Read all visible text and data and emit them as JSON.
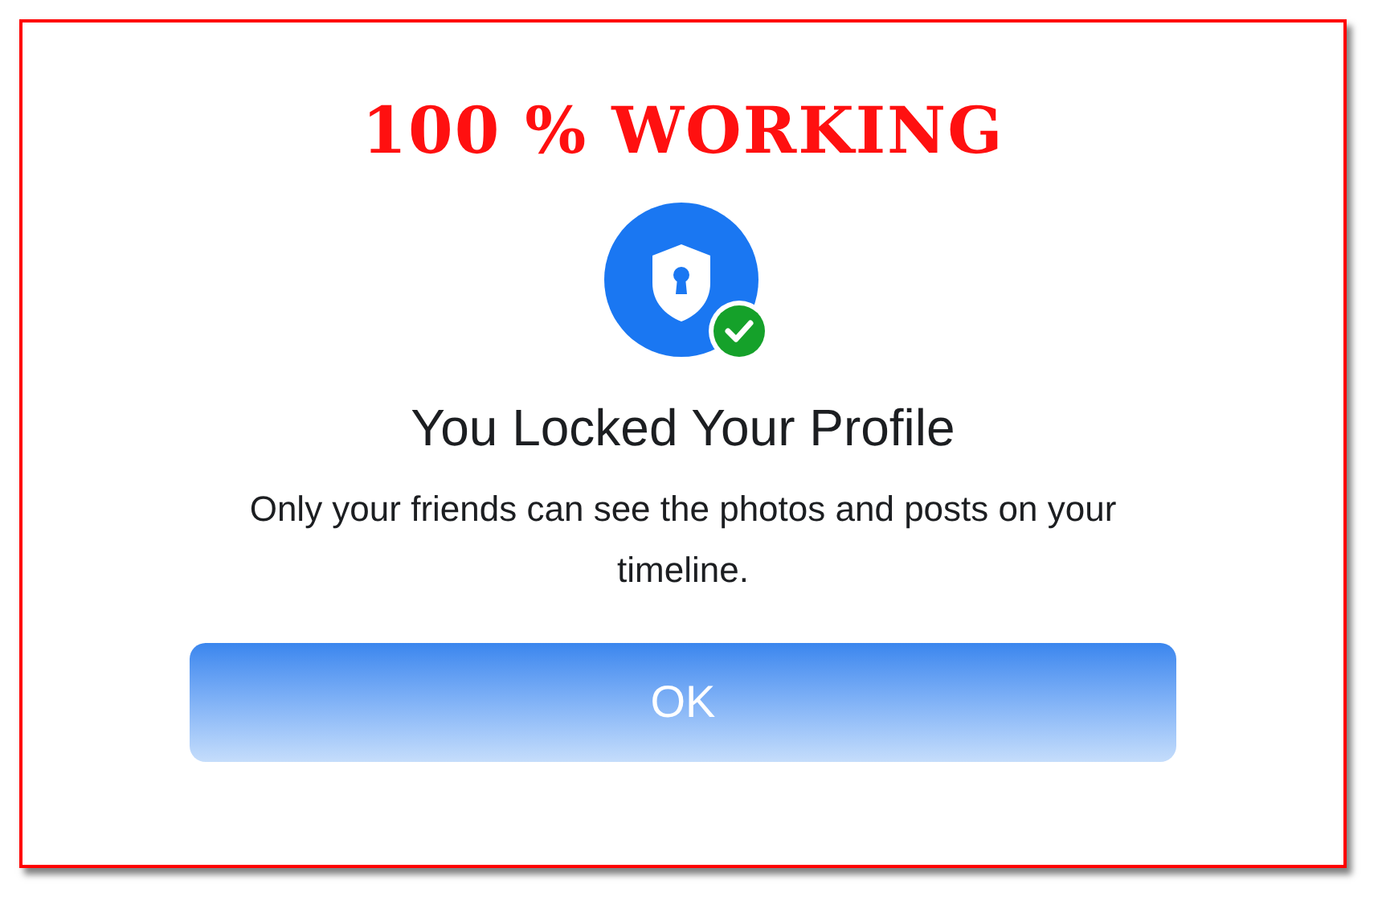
{
  "banner": "100 % WORKING",
  "dialog": {
    "title": "You Locked Your Profile",
    "message": "Only your friends can see the photos and posts on your timeline.",
    "button": "OK"
  }
}
